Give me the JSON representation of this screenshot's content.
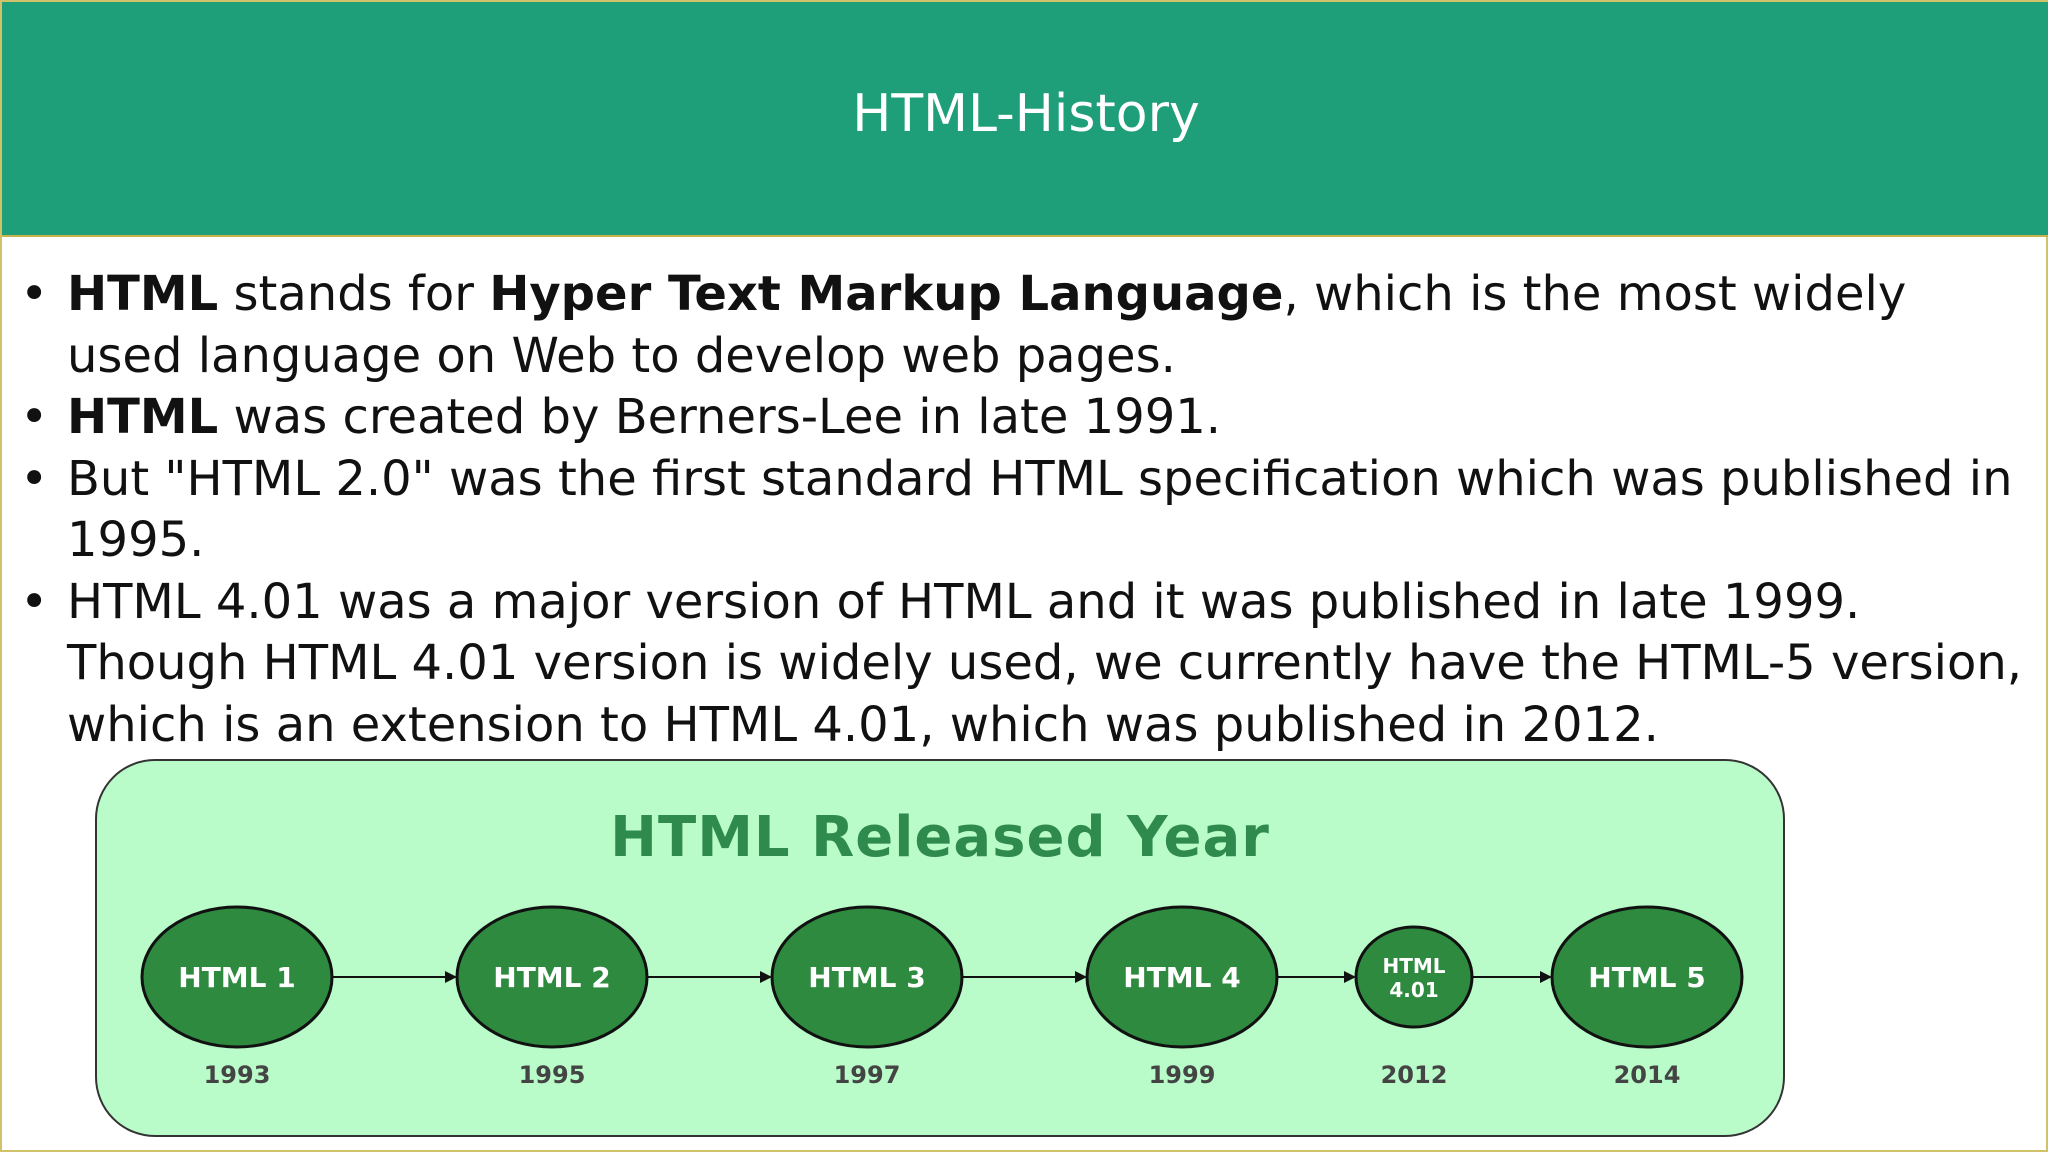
{
  "slide": {
    "title": "HTML-History",
    "bullets": [
      {
        "parts": [
          {
            "text": "HTML",
            "bold": true
          },
          {
            "text": " stands for ",
            "bold": false
          },
          {
            "text": "Hyper Text Markup Language",
            "bold": true
          },
          {
            "text": ", which is the most widely used language on Web to develop web pages.",
            "bold": false
          }
        ]
      },
      {
        "parts": [
          {
            "text": "HTML",
            "bold": true
          },
          {
            "text": " was created by Berners-Lee in late 1991.",
            "bold": false
          }
        ]
      },
      {
        "parts": [
          {
            "text": " But \"HTML 2.0\" was the first standard HTML specification which was published in 1995.",
            "bold": false
          }
        ]
      },
      {
        "parts": [
          {
            "text": " HTML 4.01 was a major version of HTML and it was published in late 1999. Though HTML 4.01 version is widely used, we currently have the HTML-5 version, which is an extension to HTML 4.01, which was published in 2012.",
            "bold": false
          }
        ]
      }
    ],
    "bullet_symbol": "•"
  },
  "diagram": {
    "title": "HTML Released Year",
    "nodes": [
      {
        "label": "HTML 1",
        "year": "1993"
      },
      {
        "label": "HTML 2",
        "year": "1995"
      },
      {
        "label": "HTML 3",
        "year": "1997"
      },
      {
        "label": "HTML 4",
        "year": "1999"
      },
      {
        "label": "HTML 4.01",
        "year": "2012"
      },
      {
        "label": "HTML 5",
        "year": "2014"
      }
    ],
    "colors": {
      "node_fill": "#2e8a3f",
      "panel_fill": "#b9fbc9",
      "title_color": "#2e8a4d",
      "header_fill": "#1e9e79"
    }
  }
}
